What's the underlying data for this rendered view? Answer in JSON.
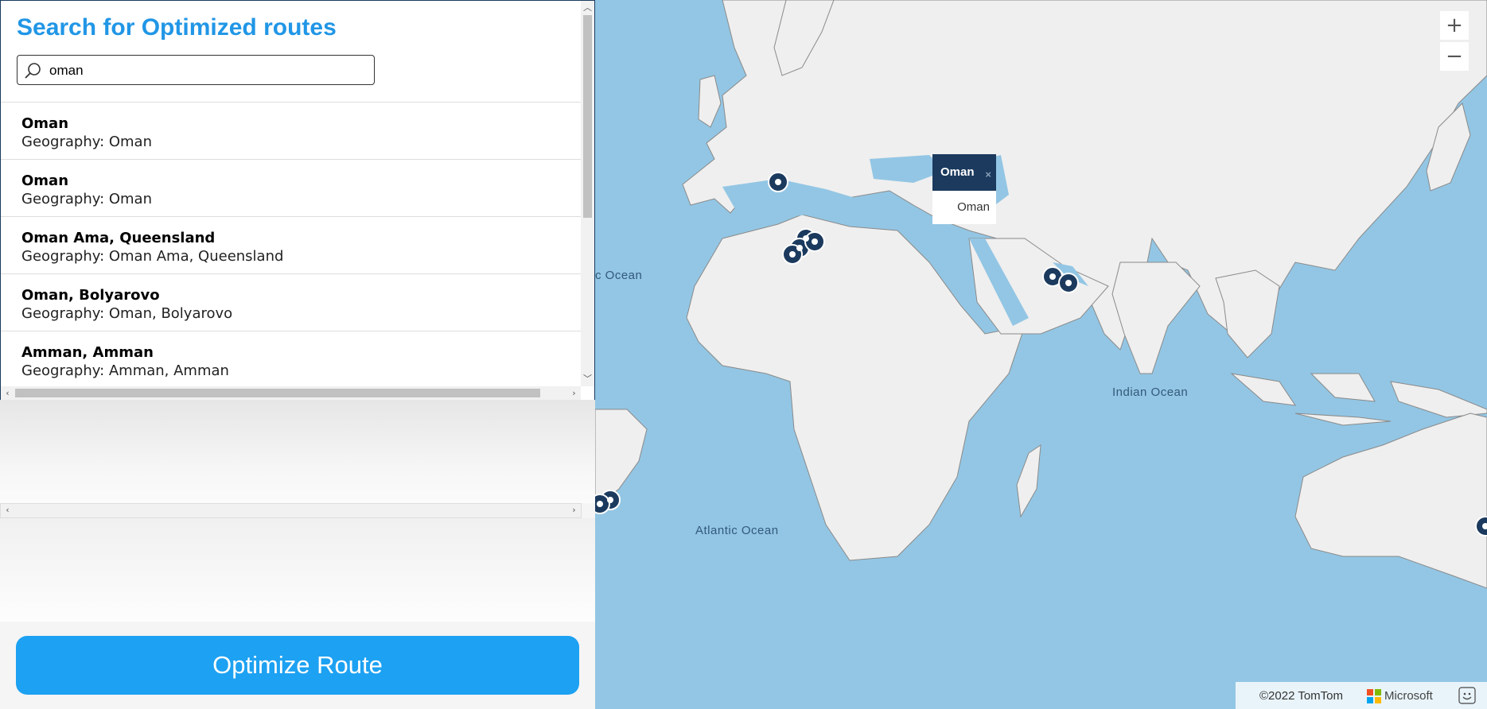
{
  "search": {
    "title": "Search for Optimized routes",
    "query": "oman",
    "results": [
      {
        "name": "Oman",
        "geography": "Geography: Oman"
      },
      {
        "name": "Oman",
        "geography": "Geography: Oman"
      },
      {
        "name": "Oman Ama, Queensland",
        "geography": "Geography: Oman Ama, Queensland"
      },
      {
        "name": "Oman, Bolyarovo",
        "geography": "Geography: Oman, Bolyarovo"
      },
      {
        "name": "Amman, Amman",
        "geography": "Geography: Amman, Amman"
      }
    ]
  },
  "actions": {
    "optimize_label": "Optimize Route"
  },
  "map": {
    "zoom_in": "+",
    "zoom_out": "−",
    "ocean_labels": {
      "atlantic_north": "c Ocean",
      "atlantic": "Atlantic Ocean",
      "indian": "Indian Ocean"
    },
    "popup": {
      "title": "Oman",
      "body": "Oman",
      "close": "×"
    },
    "attribution": {
      "copyright": "©2022 TomTom",
      "brand": "Microsoft"
    },
    "colors": {
      "water": "#93c6e4",
      "land": "#f0f0f0",
      "pin": "#1b3a5e",
      "accent": "#1da1f2"
    }
  }
}
